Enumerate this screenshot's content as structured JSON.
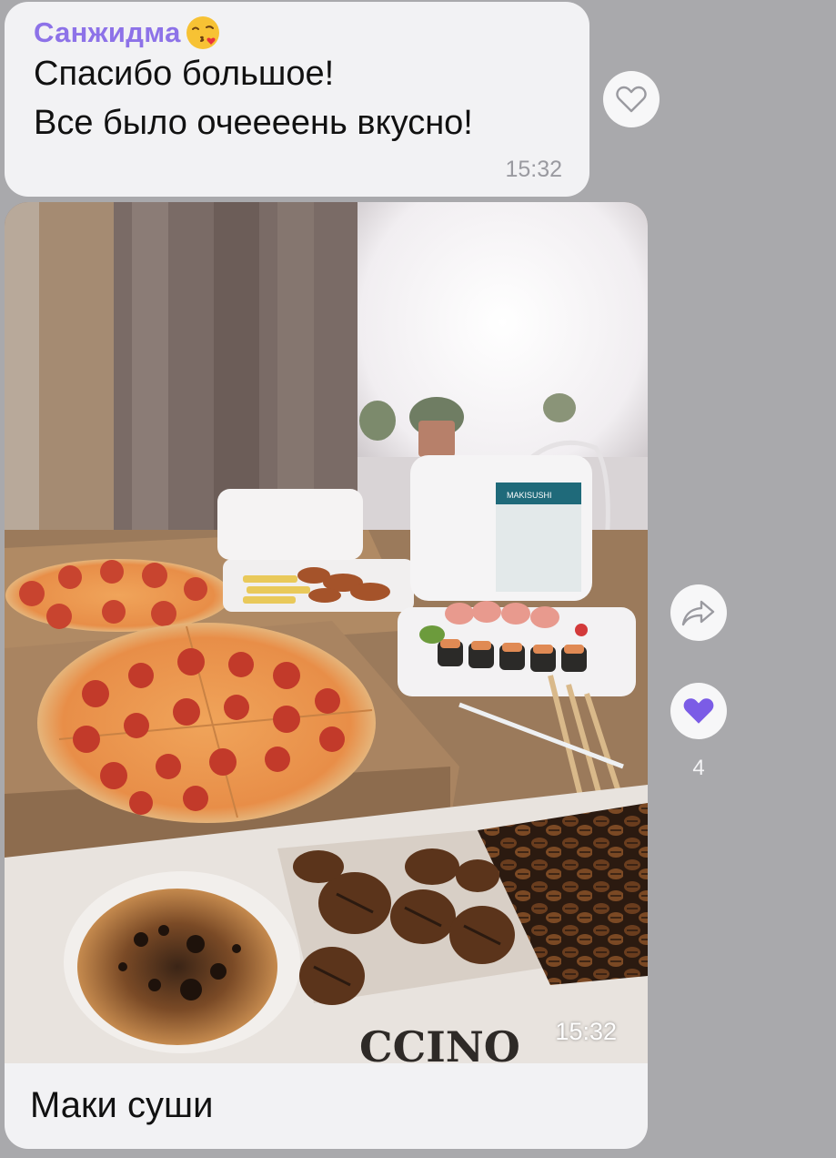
{
  "message_1": {
    "sender": "Санжидма",
    "sender_emoji": "face-blowing-kiss-icon",
    "lines": [
      "Спасибо большое!",
      "Все было очеееень вкусно!"
    ],
    "time": "15:32"
  },
  "message_2": {
    "photo_time": "15:32",
    "photo_box_label": "MAKISUSHI",
    "caption": "Маки суши"
  },
  "reactions": {
    "like_count": "4",
    "heart_color": "#7b5ce6"
  },
  "colors": {
    "sender_name": "#8d72e8",
    "background": "#a9a9ac",
    "bubble": "#f2f2f4"
  }
}
